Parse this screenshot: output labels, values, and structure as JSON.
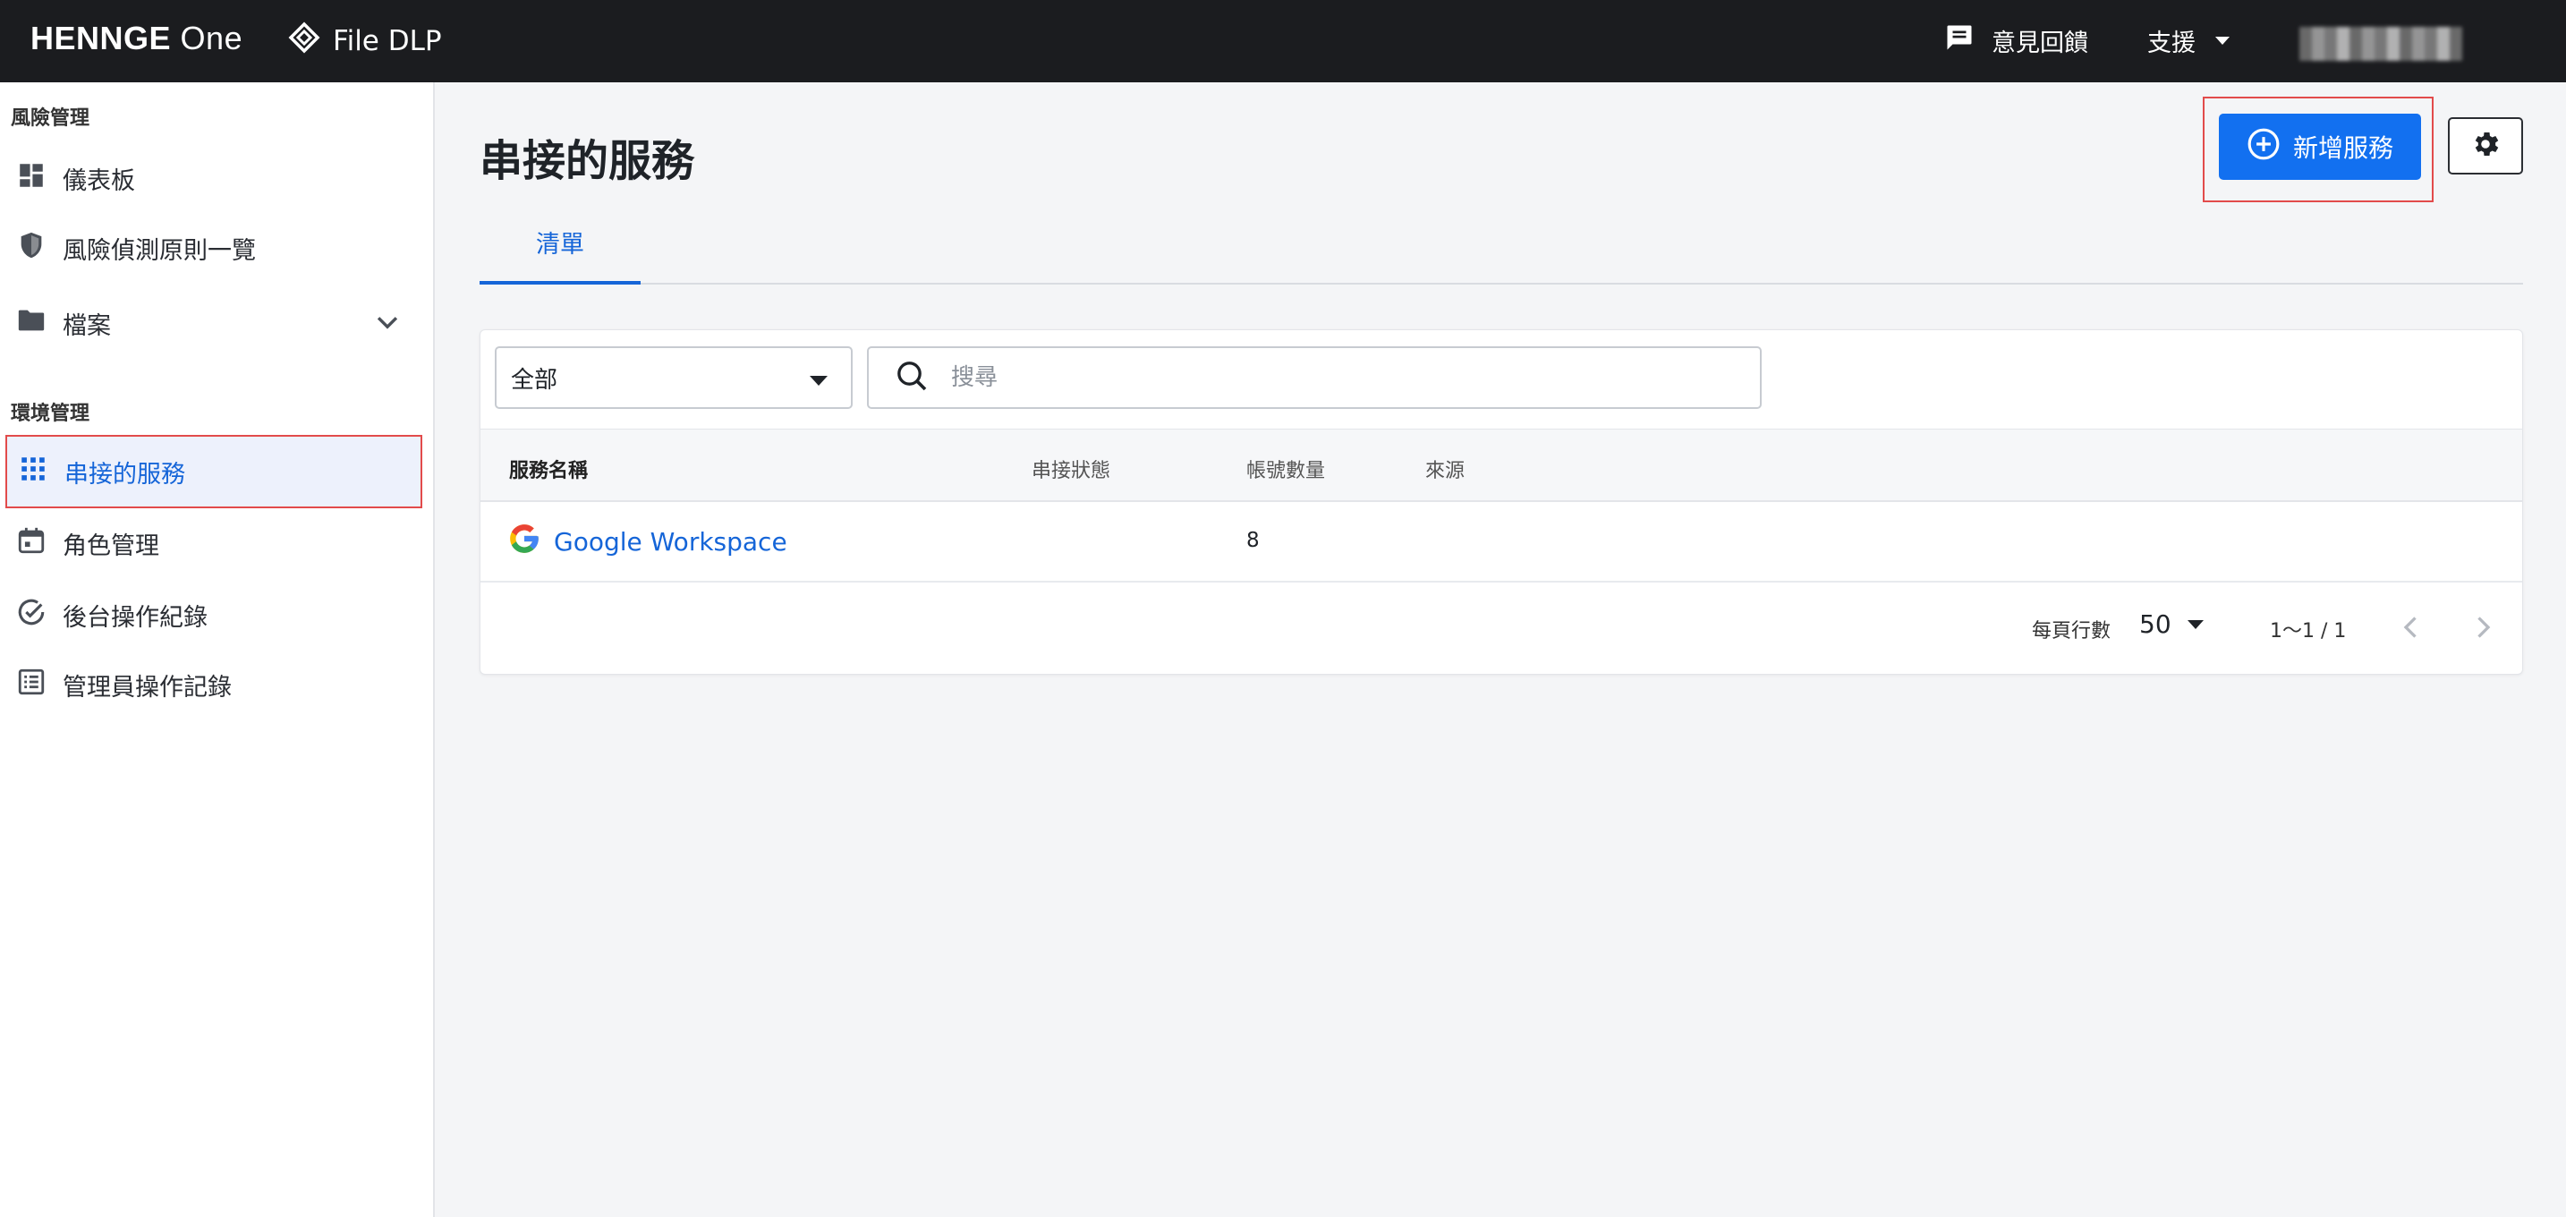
{
  "header": {
    "logo": "HENNGE One",
    "logo_brand": "HENNGE",
    "logo_suffix": "One",
    "product": "File DLP",
    "feedback": "意見回饋",
    "support": "支援"
  },
  "sidebar": {
    "sections": [
      {
        "title": "風險管理"
      },
      {
        "title": "環境管理"
      }
    ],
    "items": [
      {
        "label": "儀表板"
      },
      {
        "label": "風險偵測原則一覽"
      },
      {
        "label": "檔案"
      },
      {
        "label": "串接的服務"
      },
      {
        "label": "角色管理"
      },
      {
        "label": "後台操作紀錄"
      },
      {
        "label": "管理員操作記錄"
      }
    ]
  },
  "main": {
    "title": "串接的服務",
    "add_button": "新增服務",
    "tabs": [
      {
        "label": "清單"
      }
    ],
    "filter": {
      "selected": "全部"
    },
    "search": {
      "placeholder": "搜尋",
      "value": ""
    },
    "table": {
      "headers": [
        "服務名稱",
        "串接狀態",
        "帳號數量",
        "來源"
      ],
      "rows": [
        {
          "name": "Google Workspace",
          "status": "",
          "accounts": "8",
          "source": ""
        }
      ]
    },
    "pagination": {
      "rows_per_page_label": "每頁行數",
      "rows_per_page": "50",
      "range": "1〜1 / 1"
    }
  },
  "colors": {
    "topbar": "#1b1c1f",
    "primary": "#1270f0",
    "link": "#1565d8",
    "highlight_border": "#e24b4b",
    "google_blue": "#4285F4",
    "google_red": "#EA4335",
    "google_yellow": "#FBBC05",
    "google_green": "#34A853"
  },
  "icons": [
    "feedback-icon",
    "dashboard-icon",
    "shield-icon",
    "folder-icon",
    "chevron-down-icon",
    "grid-icon",
    "calendar-icon",
    "check-circle-icon",
    "list-icon",
    "add-circle-icon",
    "gear-icon",
    "search-icon",
    "google-logo-icon",
    "chevron-left-icon",
    "chevron-right-icon"
  ]
}
